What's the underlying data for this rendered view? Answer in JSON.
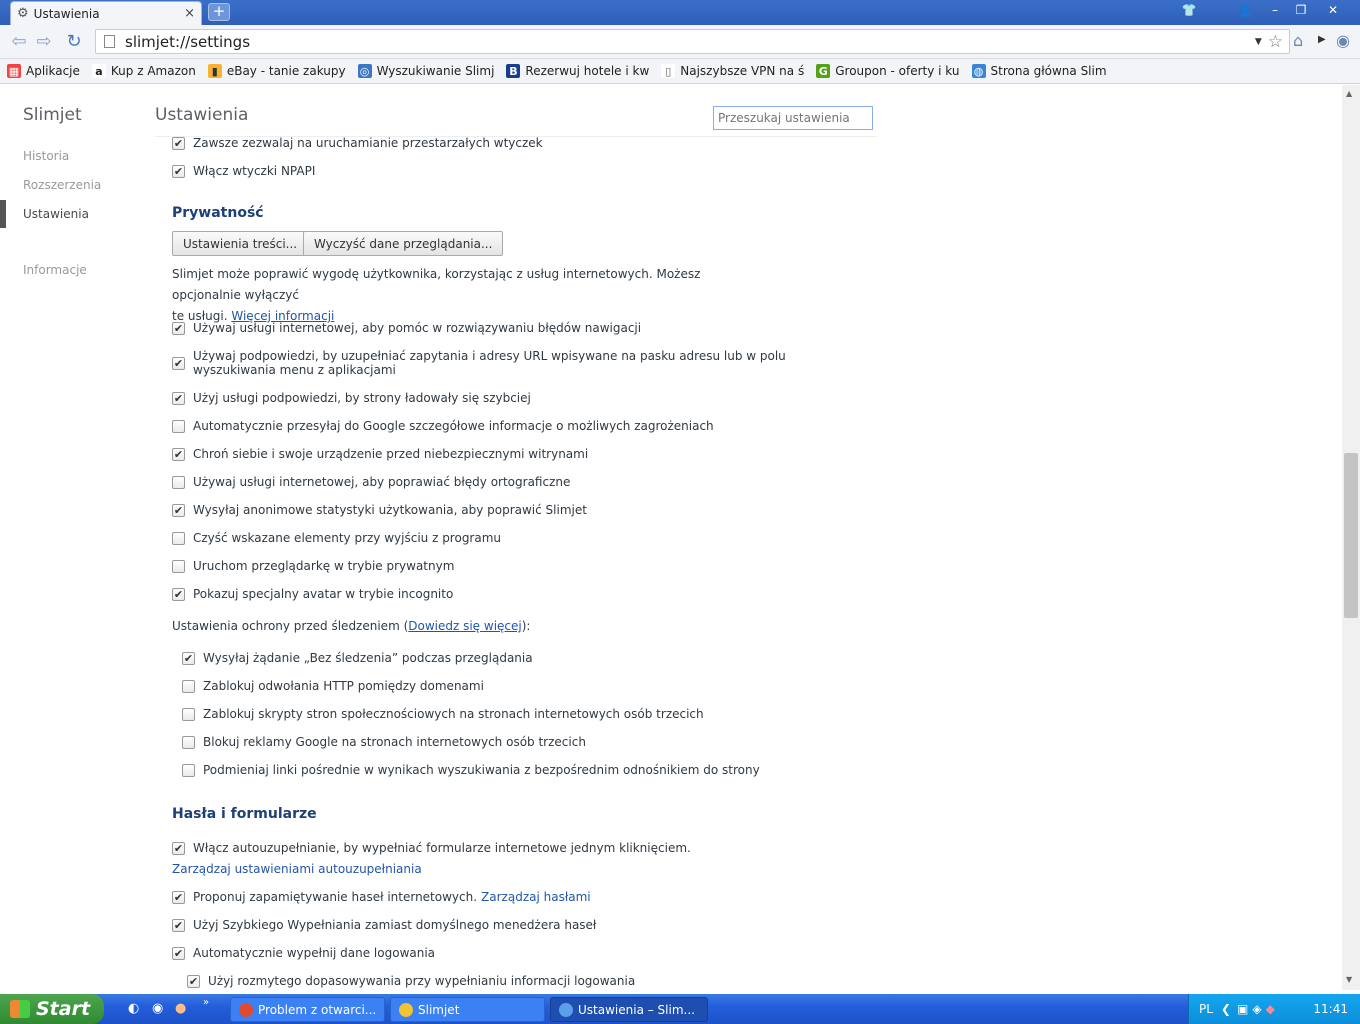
{
  "browser": {
    "tab_title": "Ustawienia",
    "tab_close": "×",
    "new_tab": "+",
    "url": "slimjet://settings",
    "bookmarks": [
      {
        "label": "Aplikacje",
        "icon": "apps-grid-icon"
      },
      {
        "label": "Kup z Amazon",
        "icon": "amazon-icon"
      },
      {
        "label": "eBay - tanie zakupy",
        "icon": "ebay-icon"
      },
      {
        "label": "Wyszukiwanie Slimj",
        "icon": "slimjet-search-icon"
      },
      {
        "label": "Rezerwuj hotele i kw",
        "icon": "booking-icon"
      },
      {
        "label": "Najszybsze VPN na ś",
        "icon": "page-icon"
      },
      {
        "label": "Groupon - oferty i ku",
        "icon": "groupon-icon"
      },
      {
        "label": "Strona główna Slim",
        "icon": "globe-icon"
      }
    ]
  },
  "nav": {
    "brand": "Slimjet",
    "items": [
      {
        "label": "Historia",
        "active": false
      },
      {
        "label": "Rozszerzenia",
        "active": false
      },
      {
        "label": "Ustawienia",
        "active": true
      },
      {
        "label": "Informacje",
        "active": false
      }
    ]
  },
  "header": {
    "title": "Ustawienia",
    "search_placeholder": "Przeszukaj ustawienia"
  },
  "plugins": {
    "items": [
      {
        "label": "Zawsze zezwalaj na uruchamianie przestarzałych wtyczek",
        "checked": true
      },
      {
        "label": "Włącz wtyczki NPAPI",
        "checked": true
      }
    ]
  },
  "privacy": {
    "title": "Prywatność",
    "content_settings_button": "Ustawienia treści...",
    "clear_data_button": "Wyczyść dane przeglądania...",
    "description": "Slimjet może poprawić wygodę użytkownika, korzystając z usług internetowych. Możesz opcjonalnie wyłączyć",
    "description_line2": "te usługi.",
    "learn_more": "Więcej informacji",
    "items": [
      {
        "label": "Używaj usługi internetowej, aby pomóc w rozwiązywaniu błędów nawigacji",
        "checked": true
      },
      {
        "label": "Używaj podpowiedzi, by uzupełniać zapytania i adresy URL wpisywane na pasku adresu lub w polu",
        "label2": "wyszukiwania menu z aplikacjami",
        "checked": true
      },
      {
        "label": "Użyj usługi podpowiedzi, by strony ładowały się szybciej",
        "checked": true
      },
      {
        "label": "Automatycznie przesyłaj do Google szczegółowe informacje o możliwych zagrożeniach",
        "checked": false
      },
      {
        "label": "Chroń siebie i swoje urządzenie przed niebezpiecznymi witrynami",
        "checked": true
      },
      {
        "label": "Używaj usługi internetowej, aby poprawiać błędy ortograficzne",
        "checked": false
      },
      {
        "label": "Wysyłaj anonimowe statystyki użytkowania, aby poprawić Slimjet",
        "checked": true
      },
      {
        "label": "Czyść wskazane elementy przy wyjściu z programu",
        "checked": false
      },
      {
        "label": "Uruchom przeglądarkę w trybie prywatnym",
        "checked": false
      },
      {
        "label": "Pokazuj specjalny avatar w trybie incognito",
        "checked": true
      }
    ],
    "tracking_label_prefix": "Ustawienia ochrony przed śledzeniem (",
    "tracking_link": "Dowiedz się więcej",
    "tracking_label_suffix": "):",
    "tracking_items": [
      {
        "label": "Wysyłaj żądanie „Bez śledzenia” podczas przeglądania",
        "checked": true
      },
      {
        "label": "Zablokuj odwołania HTTP pomiędzy domenami",
        "checked": false
      },
      {
        "label": "Zablokuj skrypty stron społecznościowych na stronach internetowych osób trzecich",
        "checked": false
      },
      {
        "label": "Blokuj reklamy Google na stronach internetowych osób trzecich",
        "checked": false
      },
      {
        "label": "Podmieniaj linki pośrednie w wynikach wyszukiwania z bezpośrednim odnośnikiem do strony",
        "checked": false
      }
    ]
  },
  "passwords": {
    "title": "Hasła i formularze",
    "autofill_label": "Włącz autouzupełnianie, by wypełniać formularze internetowe jednym kliknięciem.",
    "autofill_checked": true,
    "manage_autofill": "Zarządzaj ustawieniami autouzupełniania",
    "offer_save_label": "Proponuj zapamiętywanie haseł internetowych.",
    "offer_save_checked": true,
    "manage_passwords": "Zarządzaj hasłami",
    "quickfill_label": "Użyj Szybkiego Wypełniania zamiast domyślnego menedżera haseł",
    "quickfill_checked": true,
    "autologin_label": "Automatycznie wypełnij dane logowania",
    "autologin_checked": true,
    "fuzzy_label": "Użyj rozmytego dopasowywania przy wypełnianiu informacji logowania",
    "fuzzy_checked": true
  },
  "taskbar": {
    "start": "Start",
    "tasks": [
      {
        "label": "Problem z otwarci...",
        "active": false,
        "icon_color": "#e04a2f"
      },
      {
        "label": "Slimjet",
        "active": false,
        "icon_color": "#f1c232"
      },
      {
        "label": "Ustawienia – Slim...",
        "active": true,
        "icon_color": "#5aa0e8"
      }
    ],
    "lang": "PL",
    "clock": "11:41"
  },
  "check_glyph": "✔"
}
